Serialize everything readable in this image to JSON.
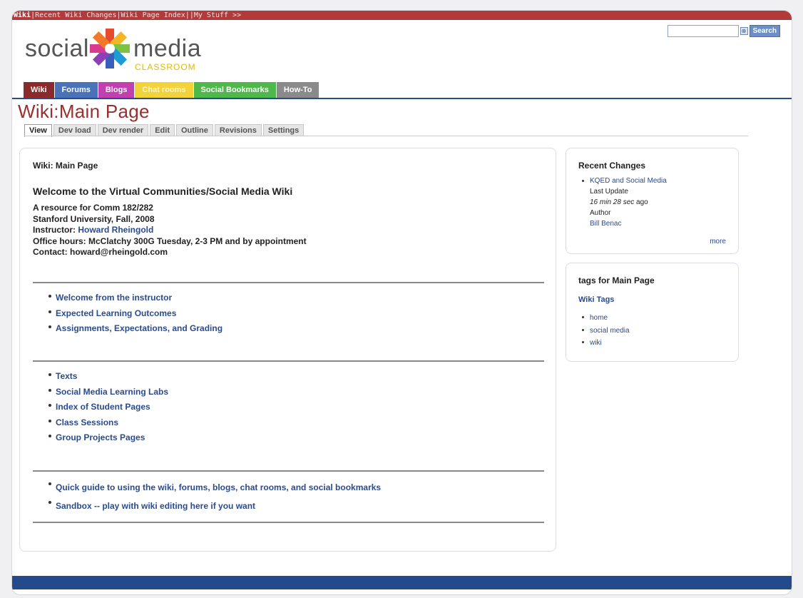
{
  "topbar": {
    "wiki": "Wiki",
    "rest": "|Recent Wiki Changes|Wiki Page Index||My Stuff >>"
  },
  "logo": {
    "word1": "social",
    "word2": "media",
    "word3": "CLASSROOM"
  },
  "search": {
    "value": "",
    "button": "Search"
  },
  "nav": [
    {
      "label": "Wiki",
      "color": "#8b2a2a"
    },
    {
      "label": "Forums",
      "color": "#4a72b8"
    },
    {
      "label": "Blogs",
      "color": "#c23fb0"
    },
    {
      "label": "Chat rooms",
      "color": "#f2d43a"
    },
    {
      "label": "Social Bookmarks",
      "color": "#4fb84a"
    },
    {
      "label": "How-To",
      "color": "#8a8a8a"
    }
  ],
  "page_title": "Wiki:Main Page",
  "subtabs": [
    "View",
    "Dev load",
    "Dev render",
    "Edit",
    "Outline",
    "Revisions",
    "Settings"
  ],
  "main": {
    "crumb": "Wiki: Main Page",
    "heading": "Welcome to the Virtual Communities/Social Media Wiki",
    "info": {
      "line1": "A resource for Comm 182/282",
      "line2": "Stanford University, Fall, 2008",
      "instructor_label": "Instructor: ",
      "instructor_name": "Howard Rheingold",
      "line4": "Office hours: McClatchy 300G Tuesday, 2-3 PM and by appointment",
      "line5": "Contact: howard@rheingold.com"
    },
    "list1": [
      "Welcome from the instructor",
      "Expected Learning Outcomes",
      "Assignments, Expectations, and Grading"
    ],
    "list2": [
      "Texts",
      "Social Media Learning Labs",
      "Index of Student Pages",
      "Class Sessions",
      "Group Projects Pages"
    ],
    "list3": [
      "Quick guide to using the wiki, forums, blogs, chat rooms, and social bookmarks",
      "Sandbox -- play with wiki editing here if you want"
    ]
  },
  "recent": {
    "title": "Recent Changes",
    "item": "KQED and Social Media",
    "last_update": "Last Update",
    "time_italic": "16 min 28 sec",
    "time_rest": " ago",
    "author_label": "Author",
    "author": "Bill Benac",
    "more": "more"
  },
  "tags": {
    "title": "tags for Main Page",
    "wiki_tags": "Wiki Tags",
    "items": [
      "home",
      "social media",
      "wiki"
    ]
  }
}
